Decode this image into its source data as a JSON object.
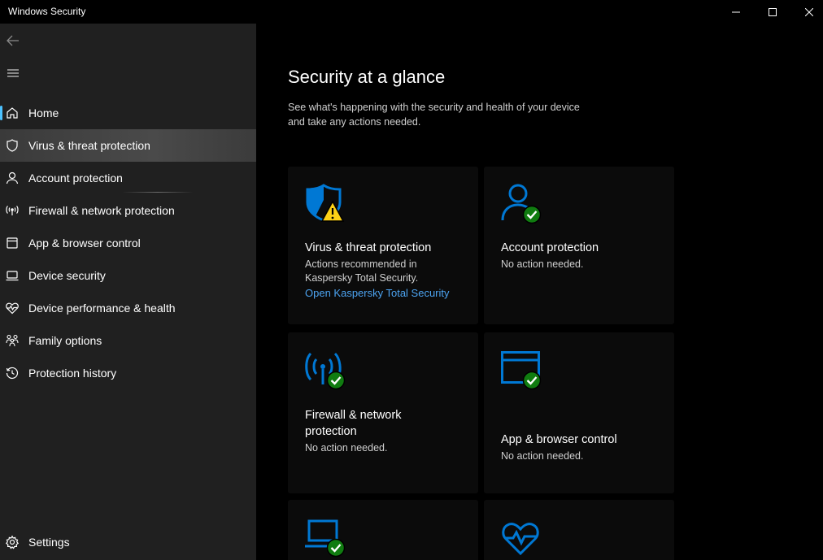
{
  "window": {
    "title": "Windows Security",
    "controls": [
      "minimize-icon",
      "maximize-icon",
      "close-icon"
    ]
  },
  "sidebar": {
    "back_icon": "back-arrow-icon",
    "menu_icon": "hamburger-menu-icon",
    "items": [
      {
        "label": "Home",
        "icon": "home-icon",
        "selected": true
      },
      {
        "label": "Virus & threat protection",
        "icon": "shield-icon",
        "hovered": true
      },
      {
        "label": "Account protection",
        "icon": "person-icon"
      },
      {
        "label": "Firewall & network protection",
        "icon": "antenna-icon"
      },
      {
        "label": "App & browser control",
        "icon": "app-window-icon"
      },
      {
        "label": "Device security",
        "icon": "laptop-icon"
      },
      {
        "label": "Device performance & health",
        "icon": "heart-icon"
      },
      {
        "label": "Family options",
        "icon": "family-icon"
      },
      {
        "label": "Protection history",
        "icon": "history-icon"
      }
    ],
    "settings": {
      "label": "Settings",
      "icon": "gear-icon"
    }
  },
  "main": {
    "title": "Security at a glance",
    "subtitle_line1": "See what's happening with the security and health of your device",
    "subtitle_line2": "and take any actions needed.",
    "cards": [
      {
        "title": "Virus & threat protection",
        "desc_line1": "Actions recommended in",
        "desc_line2": "Kaspersky Total Security.",
        "link": "Open Kaspersky Total Security",
        "icon": "shield-warning-icon",
        "status": "warning"
      },
      {
        "title": "Account protection",
        "desc": "No action needed.",
        "icon": "person-check-icon",
        "status": "ok"
      },
      {
        "title_line1": "Firewall & network",
        "title_line2": "protection",
        "desc": "No action needed.",
        "icon": "antenna-check-icon",
        "status": "ok"
      },
      {
        "title": "App & browser control",
        "desc": "No action needed.",
        "icon": "app-window-check-icon",
        "status": "ok"
      },
      {
        "icon": "laptop-check-icon",
        "status": "ok"
      },
      {
        "icon": "heart-pulse-icon"
      }
    ]
  },
  "colors": {
    "accent_blue": "#0078d4",
    "link_blue": "#4ca3f0",
    "ok_green": "#107c10",
    "warning_yellow": "#fcd116",
    "sidebar_bg": "#202020",
    "main_bg": "#000000"
  }
}
